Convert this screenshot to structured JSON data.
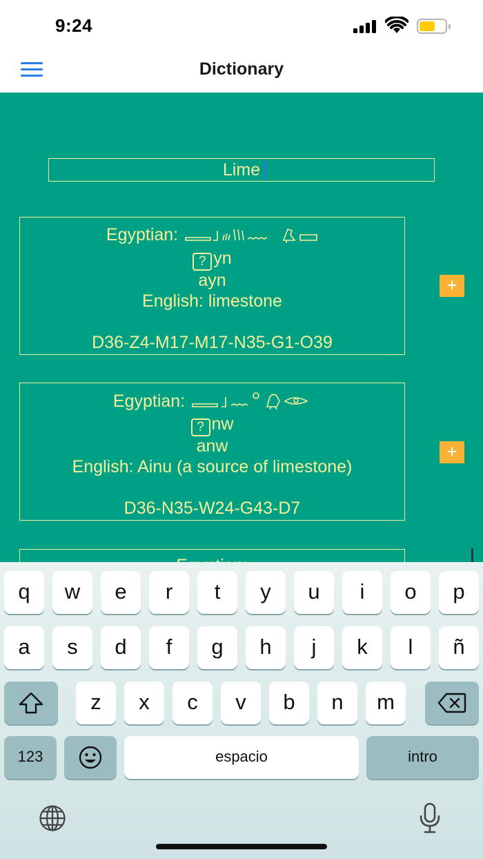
{
  "status_bar": {
    "time": "9:24",
    "battery_color": "#ffcc00"
  },
  "nav": {
    "title": "Dictionary",
    "menu_icon": "hamburger-menu-icon",
    "accent": "#2a7de1"
  },
  "search": {
    "value": "Lime"
  },
  "entries": [
    {
      "egyptian_label": "Egyptian:",
      "unknown_glyph": "?",
      "translit": "yn",
      "transcription": "ayn",
      "english": "English: limestone",
      "gardiner": "D36-Z4-M17-M17-N35-G1-O39",
      "add_label": "+"
    },
    {
      "egyptian_label": "Egyptian:",
      "unknown_glyph": "?",
      "translit": "nw",
      "transcription": "anw",
      "english": "English: Ainu (a source of limestone)",
      "gardiner": "D36-N35-W24-G43-D7",
      "add_label": "+"
    },
    {
      "egyptian_label": "Egyptian:"
    }
  ],
  "colors": {
    "background": "#00a085",
    "text": "#f5ef9b",
    "add_button": "#fbb234"
  },
  "keyboard": {
    "row1": [
      "q",
      "w",
      "e",
      "r",
      "t",
      "y",
      "u",
      "i",
      "o",
      "p"
    ],
    "row2": [
      "a",
      "s",
      "d",
      "f",
      "g",
      "h",
      "j",
      "k",
      "l",
      "ñ"
    ],
    "row3": [
      "z",
      "x",
      "c",
      "v",
      "b",
      "n",
      "m"
    ],
    "numbers_label": "123",
    "space_label": "espacio",
    "return_label": "intro"
  }
}
